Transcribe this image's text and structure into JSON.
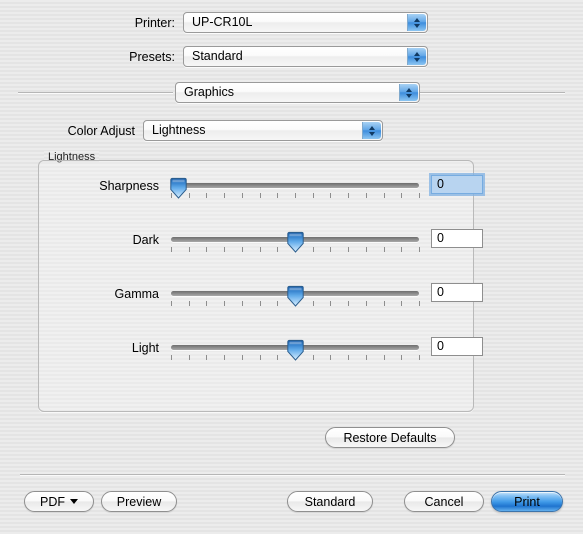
{
  "dialog": {
    "printer": {
      "label": "Printer:",
      "value": "UP-CR10L"
    },
    "presets": {
      "label": "Presets:",
      "value": "Standard"
    },
    "pane": {
      "value": "Graphics"
    },
    "color_adjust": {
      "label": "Color Adjust",
      "value": "Lightness"
    },
    "group": {
      "legend": "Lightness",
      "sliders": [
        {
          "label": "Sharpness",
          "value": "0",
          "position_pct": 3,
          "focused": true
        },
        {
          "label": "Dark",
          "value": "0",
          "position_pct": 50,
          "focused": false
        },
        {
          "label": "Gamma",
          "value": "0",
          "position_pct": 50,
          "focused": false
        },
        {
          "label": "Light",
          "value": "0",
          "position_pct": 50,
          "focused": false
        }
      ],
      "tick_count": 15
    },
    "restore_defaults_label": "Restore Defaults",
    "footer": {
      "pdf_label": "PDF",
      "preview_label": "Preview",
      "standard_label": "Standard",
      "cancel_label": "Cancel",
      "print_label": "Print"
    },
    "colors": {
      "accent_blue": "#3f9ae8",
      "window_bg": "#ececec",
      "focus_fill": "#b8d4f0"
    }
  }
}
